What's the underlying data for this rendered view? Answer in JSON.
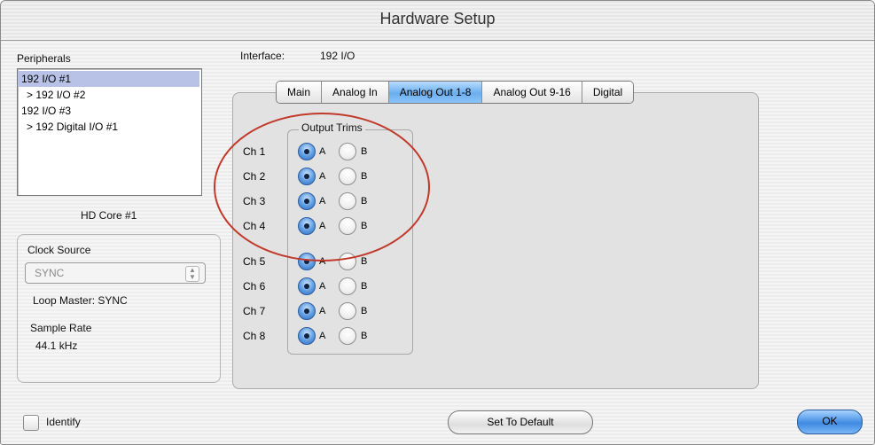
{
  "window": {
    "title": "Hardware Setup"
  },
  "peripherals": {
    "label": "Peripherals",
    "items": [
      {
        "label": "192 I/O #1"
      },
      {
        "label": "> 192 I/O #2"
      },
      {
        "label": "192 I/O #3"
      },
      {
        "label": "> 192 Digital I/O #1"
      }
    ],
    "selected_index": 0,
    "core_label": "HD Core #1"
  },
  "interface": {
    "label": "Interface:",
    "value": "192 I/O"
  },
  "clock": {
    "label": "Clock Source",
    "select_value": "SYNC",
    "loop_master": "Loop Master: SYNC",
    "sample_rate_label": "Sample Rate",
    "sample_rate_value": "44.1 kHz"
  },
  "tabs": [
    {
      "label": "Main"
    },
    {
      "label": "Analog In"
    },
    {
      "label": "Analog Out 1-8",
      "active": true
    },
    {
      "label": "Analog Out 9-16"
    },
    {
      "label": "Digital"
    }
  ],
  "output_trims": {
    "title": "Output Trims",
    "option_a": "A",
    "option_b": "B",
    "channels": [
      {
        "label": "Ch 1",
        "selected": "A"
      },
      {
        "label": "Ch 2",
        "selected": "A"
      },
      {
        "label": "Ch 3",
        "selected": "A"
      },
      {
        "label": "Ch 4",
        "selected": "A"
      },
      {
        "label": "Ch 5",
        "selected": "A"
      },
      {
        "label": "Ch 6",
        "selected": "A"
      },
      {
        "label": "Ch 7",
        "selected": "A"
      },
      {
        "label": "Ch 8",
        "selected": "A"
      }
    ]
  },
  "footer": {
    "identify_label": "Identify",
    "identify_checked": false,
    "set_default_label": "Set To Default",
    "ok_label": "OK"
  },
  "colors": {
    "selection": "#b8c2e6",
    "accent": "#5d9be0",
    "annotation": "#c0392b"
  }
}
